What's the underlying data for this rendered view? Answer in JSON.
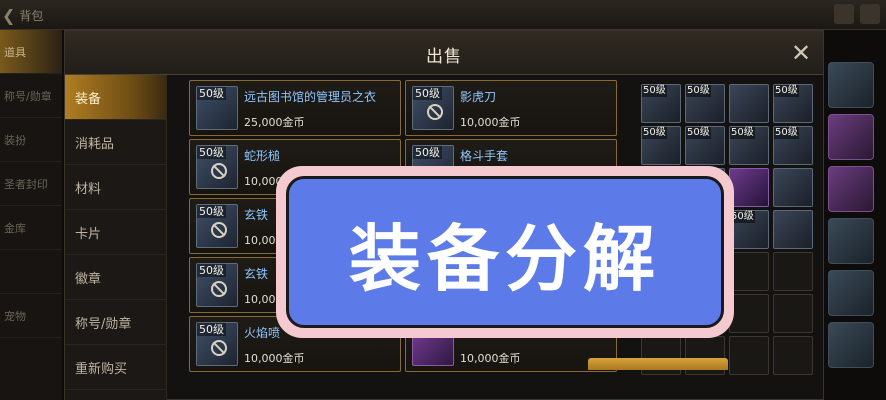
{
  "background": {
    "back_label": "背包",
    "left_nav": [
      "道具",
      "称号/勋章",
      "装扮",
      "圣者封印",
      "金库",
      "",
      "宠物"
    ],
    "left_nav_active": 0
  },
  "modal": {
    "title": "出售",
    "close_icon": "close-icon",
    "categories": [
      "装备",
      "消耗品",
      "材料",
      "卡片",
      "徽章",
      "称号/勋章",
      "重新购买"
    ],
    "active_category": 0,
    "items": [
      {
        "level": "50级",
        "name": "远古图书馆的管理员之衣",
        "price": "25,000金币",
        "icon": "armor-icon",
        "tint": "blue"
      },
      {
        "level": "50级",
        "name": "影虎刀",
        "price": "10,000金币",
        "icon": "sword-icon",
        "tint": "blue"
      },
      {
        "level": "50级",
        "name": "蛇形槌",
        "price": "10,000金币",
        "icon": "mace-icon",
        "tint": "blue"
      },
      {
        "level": "50级",
        "name": "格斗手套",
        "price": "",
        "icon": "gauntlet-icon",
        "tint": "blue"
      },
      {
        "level": "50级",
        "name": "玄铁",
        "price": "10,000金币",
        "icon": "armor-icon",
        "tint": "blue"
      },
      {
        "level": "",
        "name": "",
        "price": "",
        "icon": "armor-icon",
        "tint": "blue"
      },
      {
        "level": "50级",
        "name": "玄铁",
        "price": "10,000金币",
        "icon": "armor-icon",
        "tint": "blue"
      },
      {
        "level": "",
        "name": "",
        "price": "",
        "icon": "armor-icon",
        "tint": "blue"
      },
      {
        "level": "50级",
        "name": "火焰喷",
        "price": "10,000金币",
        "icon": "flamethrower-icon",
        "tint": "blue"
      },
      {
        "level": "",
        "name": "",
        "price": "10,000金币",
        "icon": "armor-icon",
        "tint": "purple"
      }
    ],
    "inventory_level_labels": [
      "50级",
      "50级",
      "50级",
      "50级",
      "50级",
      "50级",
      "50级",
      "50级"
    ]
  },
  "banner": {
    "text": "装备分解",
    "fill_color": "#5d7be8",
    "frame_color": "#f4c9cf"
  }
}
